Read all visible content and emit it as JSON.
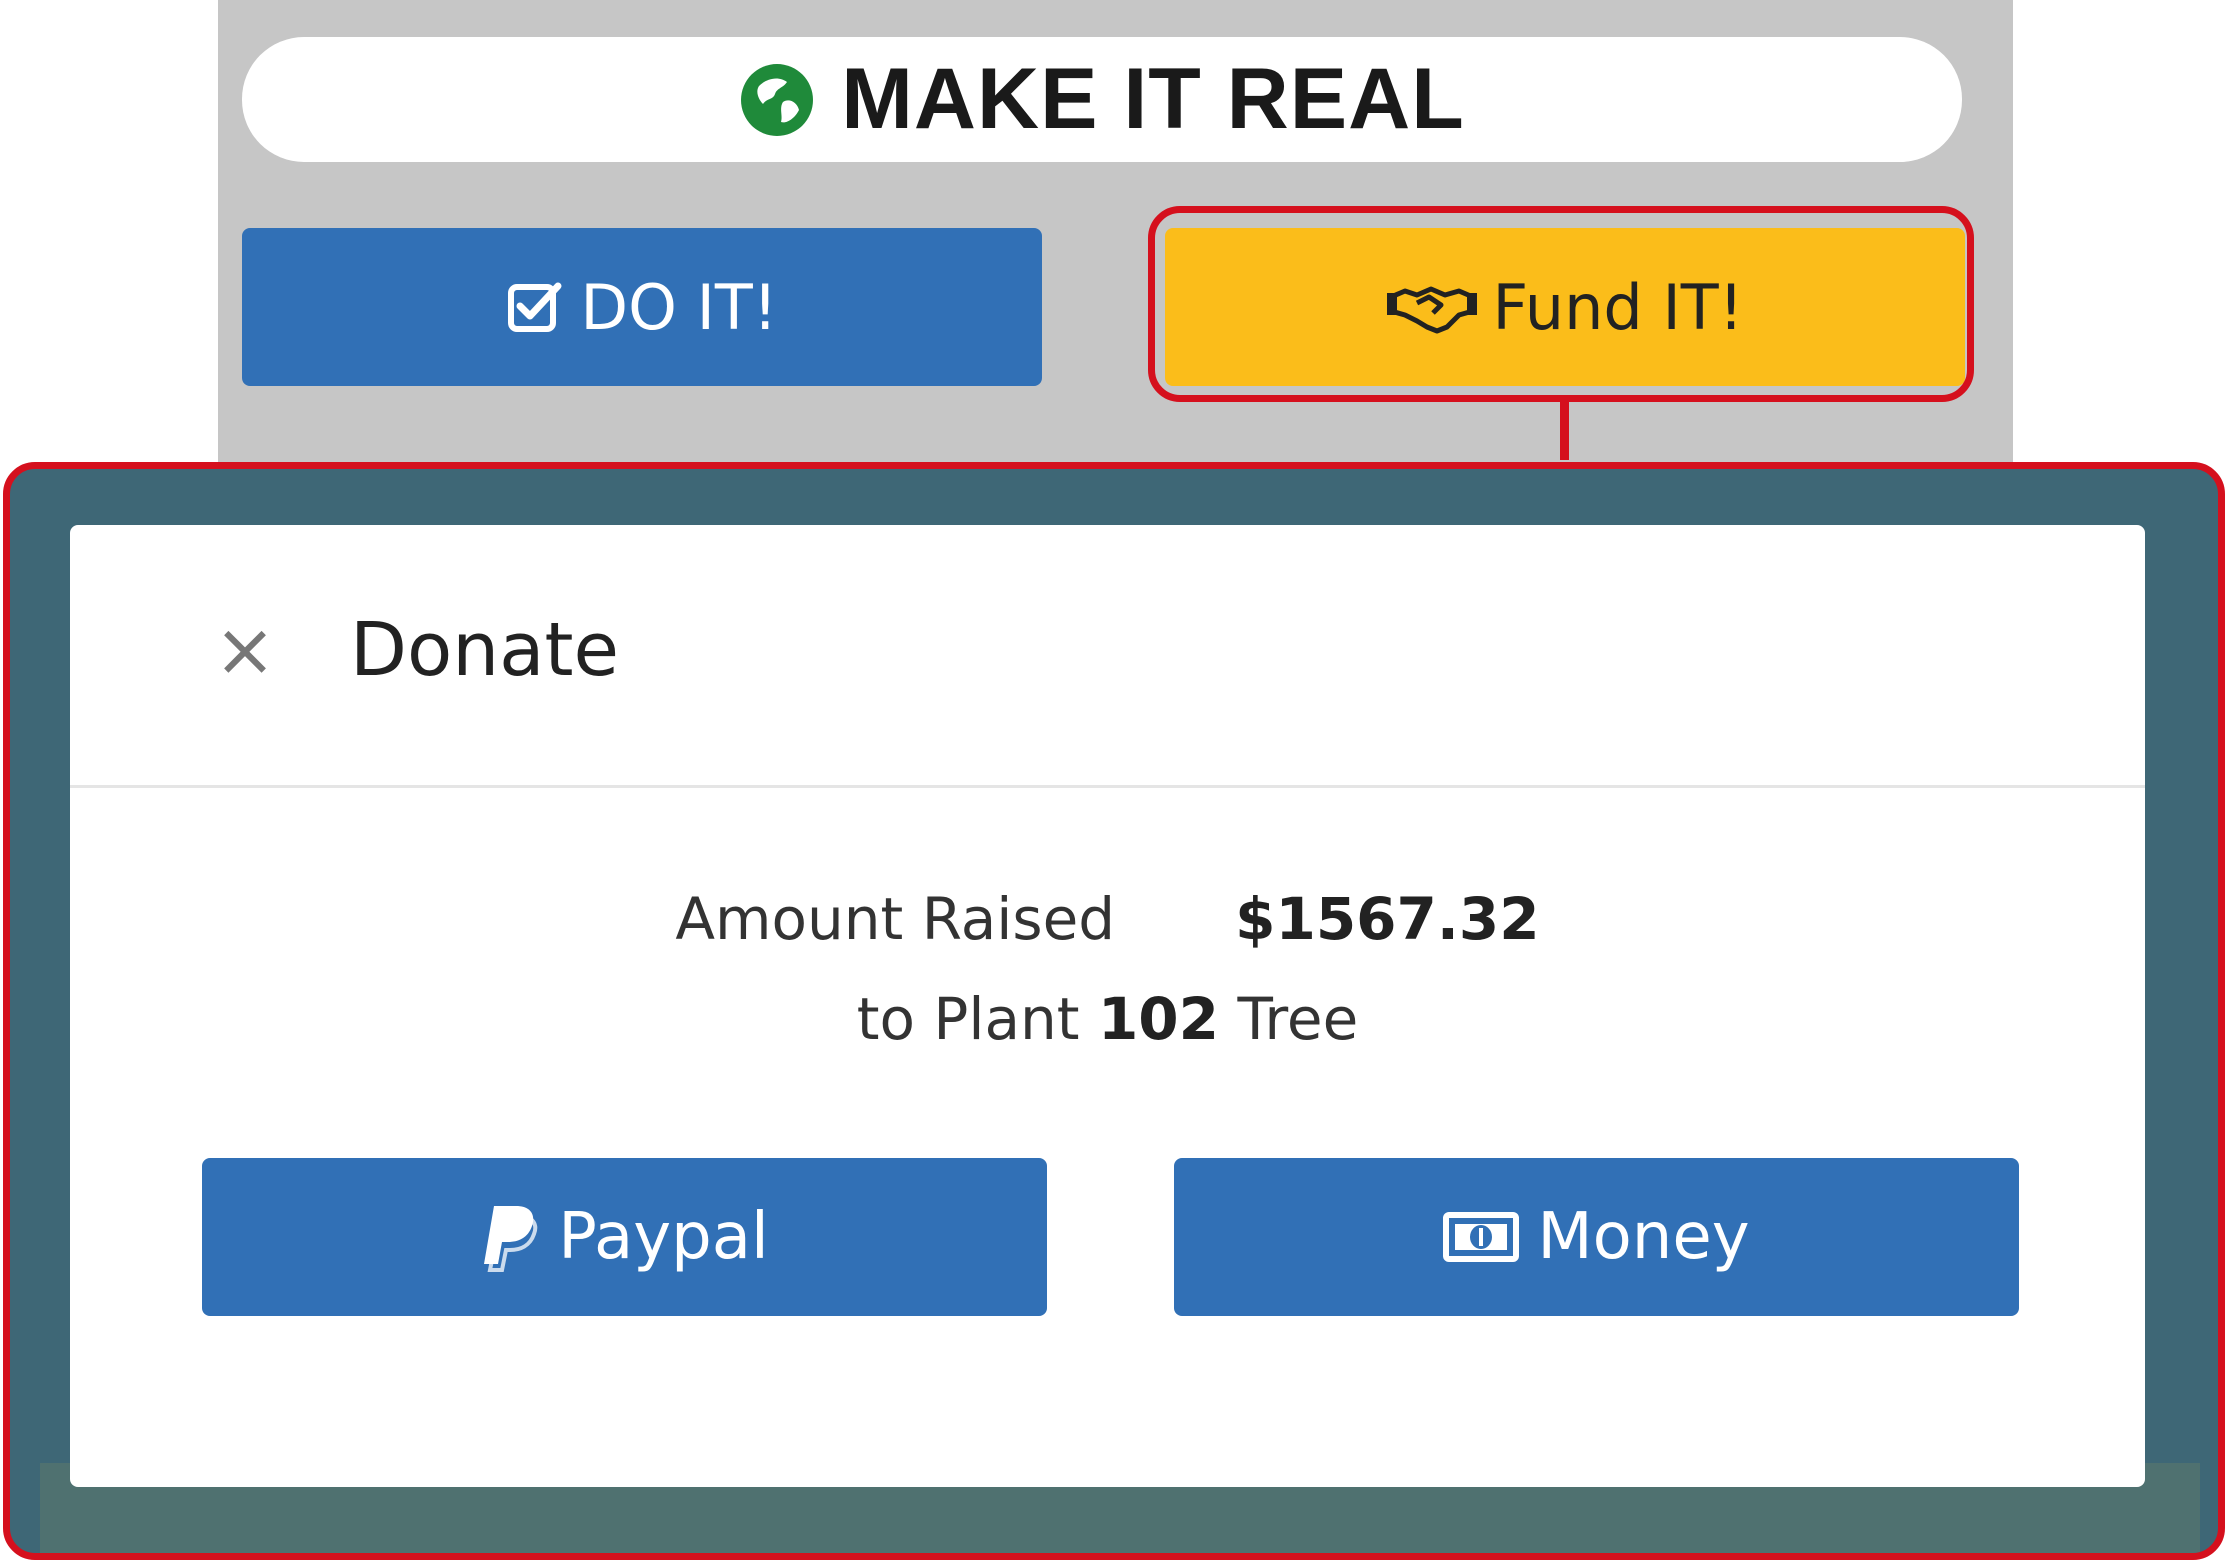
{
  "header": {
    "title": "MAKE IT REAL",
    "logo_icon": "globe-icon",
    "panel_color": "#c6c6c6"
  },
  "actions": {
    "do_it": {
      "label": "DO IT!",
      "icon": "checkbox-icon",
      "color": "#3170b6"
    },
    "fund_it": {
      "label": "Fund IT!",
      "icon": "handshake-icon",
      "color": "#fbbd1a"
    }
  },
  "highlight_color": "#d5101d",
  "modal": {
    "title": "Donate",
    "close_symbol": "×",
    "amount_label": "Amount Raised",
    "amount_value": "$1567.32",
    "plant_prefix": "to Plant",
    "tree_count": "102",
    "plant_suffix": "Tree",
    "buttons": {
      "paypal": {
        "label": "Paypal",
        "icon": "paypal-icon"
      },
      "money": {
        "label": "Money",
        "icon": "banknote-icon"
      }
    },
    "button_color": "#3170b6",
    "overlay_color": "#3e6776"
  }
}
